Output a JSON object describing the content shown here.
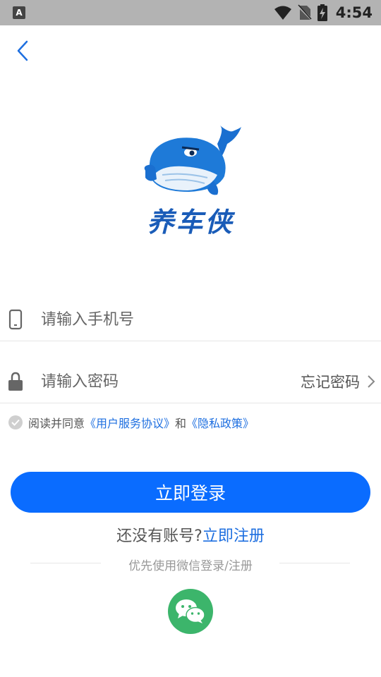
{
  "status_bar": {
    "app_icon": "A",
    "time": "4:54",
    "icons": [
      "wifi-icon",
      "no-sim-icon",
      "battery-charging-icon"
    ]
  },
  "brand": {
    "name": "养车侠"
  },
  "form": {
    "phone_placeholder": "请输入手机号",
    "password_placeholder": "请输入密码",
    "forgot_label": "忘记密码"
  },
  "agreement": {
    "prefix": "阅读并同意",
    "terms_link": "《用户服务协议》",
    "connector": "和",
    "privacy_link": "《隐私政策》"
  },
  "login_button": "立即登录",
  "register": {
    "prompt": "还没有账号?",
    "link": "立即注册"
  },
  "wechat_tip": "优先使用微信登录/注册",
  "colors": {
    "primary": "#0a6cff",
    "link": "#1e6fe0",
    "wechat": "#3cb56b",
    "status_bar": "#b3b3b3"
  }
}
